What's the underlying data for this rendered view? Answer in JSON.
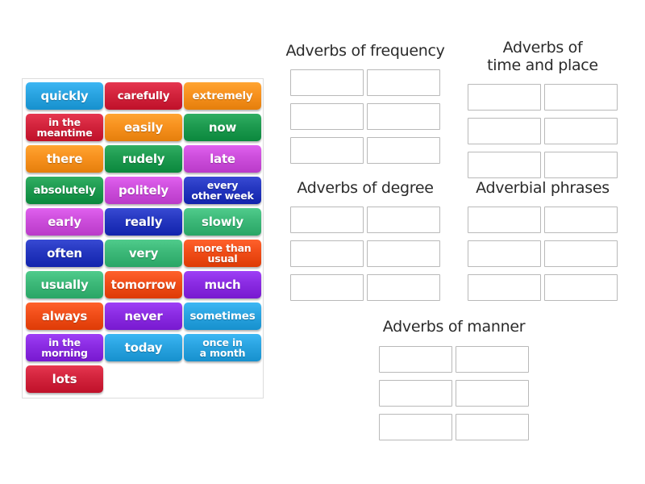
{
  "activity": {
    "type": "group-sort",
    "tile_panel": {
      "columns": 3,
      "rows": 11,
      "tiles": [
        {
          "label": "quickly",
          "color": "#29a3e0",
          "lines": 1
        },
        {
          "label": "carefully",
          "color": "#d2233c",
          "lines": 1
        },
        {
          "label": "extremely",
          "color": "#f7911e",
          "lines": 1
        },
        {
          "label": "in the\nmeantime",
          "color": "#d2233c",
          "lines": 2
        },
        {
          "label": "easily",
          "color": "#f7911e",
          "lines": 1
        },
        {
          "label": "now",
          "color": "#1d9a4f",
          "lines": 1
        },
        {
          "label": "there",
          "color": "#f7911e",
          "lines": 1
        },
        {
          "label": "rudely",
          "color": "#1d9a4f",
          "lines": 1
        },
        {
          "label": "late",
          "color": "#cc4ddb",
          "lines": 1
        },
        {
          "label": "absolutely",
          "color": "#1d9a4f",
          "lines": 1
        },
        {
          "label": "politely",
          "color": "#cc4ddb",
          "lines": 1
        },
        {
          "label": "every\nother week",
          "color": "#2436bf",
          "lines": 2
        },
        {
          "label": "early",
          "color": "#cc4ddb",
          "lines": 1
        },
        {
          "label": "really",
          "color": "#2436bf",
          "lines": 1
        },
        {
          "label": "slowly",
          "color": "#3cb878",
          "lines": 1
        },
        {
          "label": "often",
          "color": "#2436bf",
          "lines": 1
        },
        {
          "label": "very",
          "color": "#3cb878",
          "lines": 1
        },
        {
          "label": "more than\nusual",
          "color": "#f04d18",
          "lines": 2
        },
        {
          "label": "usually",
          "color": "#3cb878",
          "lines": 1
        },
        {
          "label": "tomorrow",
          "color": "#f04d18",
          "lines": 1
        },
        {
          "label": "much",
          "color": "#8a2be2",
          "lines": 1
        },
        {
          "label": "always",
          "color": "#f04d18",
          "lines": 1
        },
        {
          "label": "never",
          "color": "#8a2be2",
          "lines": 1
        },
        {
          "label": "sometimes",
          "color": "#29a3e0",
          "lines": 1
        },
        {
          "label": "in the\nmorning",
          "color": "#8a2be2",
          "lines": 2
        },
        {
          "label": "today",
          "color": "#29a3e0",
          "lines": 1
        },
        {
          "label": "once in\na month",
          "color": "#29a3e0",
          "lines": 2
        },
        {
          "label": "lots",
          "color": "#d2233c",
          "lines": 1
        }
      ]
    },
    "groups": [
      {
        "id": "frequency",
        "title": "Adverbs of frequency",
        "slot_count": 6,
        "filled": []
      },
      {
        "id": "timeplace",
        "title": "Adverbs of\ntime and place",
        "slot_count": 6,
        "filled": []
      },
      {
        "id": "degree",
        "title": "Adverbs of degree",
        "slot_count": 6,
        "filled": []
      },
      {
        "id": "phrases",
        "title": "Adverbial phrases",
        "slot_count": 6,
        "filled": []
      },
      {
        "id": "manner",
        "title": "Adverbs of manner",
        "slot_count": 6,
        "filled": []
      }
    ]
  }
}
